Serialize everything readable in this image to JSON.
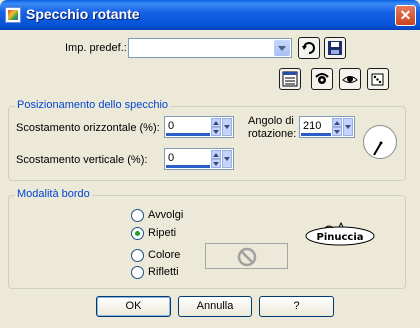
{
  "window": {
    "title": "Specchio rotante",
    "close_glyph": "✕"
  },
  "preset": {
    "label": "Imp. predef.:",
    "value": ""
  },
  "toolbar_icons": [
    "reset-icon",
    "save-preset-icon",
    "dialog-icon",
    "camera-icon",
    "eye-icon",
    "randomize-dice-icon"
  ],
  "position_group": {
    "title": "Posizionamento dello specchio",
    "horizontal_label": "Scostamento orizzontale (%):",
    "horizontal_value": "0",
    "vertical_label": "Scostamento verticale (%):",
    "vertical_value": "0",
    "angle_label_line1": "Angolo di",
    "angle_label_line2": "rotazione:",
    "angle_value": "210"
  },
  "border_group": {
    "title": "Modalità bordo",
    "options": [
      {
        "label": "Avvolgi",
        "checked": false
      },
      {
        "label": "Ripeti",
        "checked": true
      },
      {
        "label": "Colore",
        "checked": false
      },
      {
        "label": "Rifletti",
        "checked": false
      }
    ],
    "watermark": "Pinuccia"
  },
  "buttons": {
    "ok": "OK",
    "cancel": "Annulla",
    "help": "?"
  }
}
